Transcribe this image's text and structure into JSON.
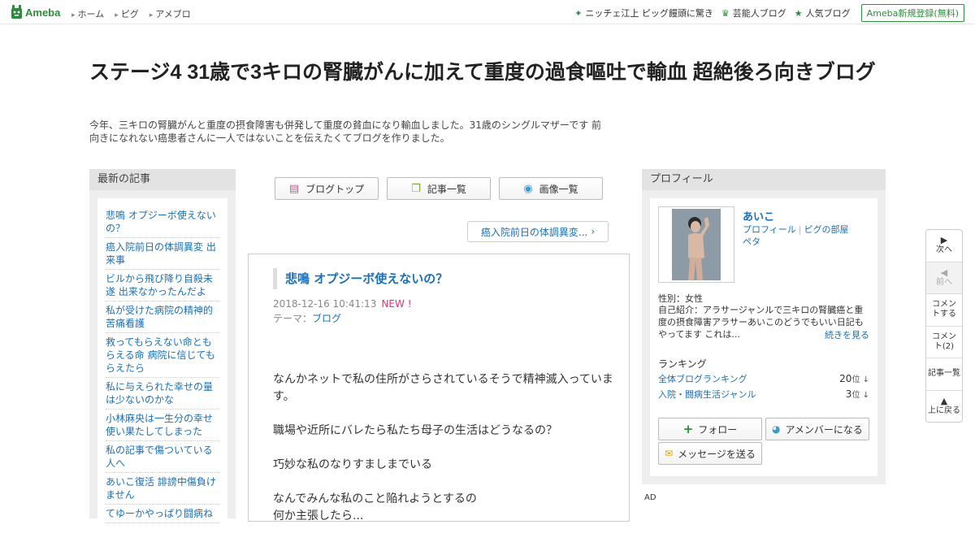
{
  "topbar": {
    "logo_text": "Ameba",
    "nav": [
      "ホーム",
      "ピグ",
      "アメブロ"
    ],
    "links": [
      {
        "icon": "sparkle-icon",
        "label": "ニッチェ江上 ピッグ饅頭に驚き"
      },
      {
        "icon": "crown-icon",
        "label": "芸能人ブログ"
      },
      {
        "icon": "star-icon",
        "label": "人気ブログ"
      }
    ],
    "register_label": "Ameba新規登録(無料)"
  },
  "header": {
    "title": "ステージ4 31歳で3キロの腎臓がんに加えて重度の過食嘔吐で輸血 超絶後ろ向きブログ",
    "description": "今年、三キロの腎臓がんと重度の摂食障害も併発して重度の貧血になり輸血しました。31歳のシングルマザーです 前向きになれない癌患者さんに一人ではないことを伝えたくてブログを作りました。"
  },
  "left": {
    "heading": "最新の記事",
    "items": [
      "悲鳴 オプジーボ使えないの？",
      "癌入院前日の体調異変 出来事",
      "ビルから飛び降り自殺未遂 出来なかったんだよ",
      "私が受けた病院の精神的苦痛看護",
      "救ってもらえない命ともらえる命 病院に信じてもらえたら",
      "私に与えられた幸せの量は少ないのかな",
      "小林麻央は一生分の幸せ使い果たしてしまった",
      "私の記事で傷ついている人へ",
      "あいこ復活 誹謗中傷負けません",
      "てゆーかやっぱり闘病ね"
    ]
  },
  "center": {
    "tabs": [
      "ブログトップ",
      "記事一覧",
      "画像一覧"
    ],
    "prev_entry": "癌入院前日の体調異変...",
    "article": {
      "title": "悲鳴 オプジーボ使えないの？",
      "date": "2018-12-16 10:41:13",
      "new_badge": "NEW !",
      "theme_label": "テーマ：",
      "theme": "ブログ",
      "paragraphs": [
        "なんかネットで私の住所がさらされているそうで精神滅入っています。",
        "職場や近所にバレたら私たち母子の生活はどうなるの？",
        "巧妙な私のなりすましまでいる",
        "なんでみんな私のこと陥れようとするの",
        "何か主張したら..."
      ]
    }
  },
  "right": {
    "heading": "プロフィール",
    "name": "あいこ",
    "link_profile": "プロフィール",
    "link_pig": "ピグの部屋",
    "link_peta": "ペタ",
    "gender": "性別：女性",
    "intro": "自己紹介：アラサージャンルで三キロの腎臓癌と重度の摂食障害アラサーあいこのどうでもいい日記もやってます これは...",
    "more": "続きを見る",
    "ranking_heading": "ランキング",
    "ranking": [
      {
        "label": "全体ブログランキング",
        "value": "20",
        "unit": "位 ↓"
      },
      {
        "label": "入院・闘病生活ジャンル",
        "value": "3",
        "unit": "位 ↓"
      }
    ],
    "follow": "フォロー",
    "amember": "アメンバーになる",
    "message": "メッセージを送る",
    "ad": "AD"
  },
  "sidenav": {
    "next": "次へ",
    "prev": "前へ",
    "comment": "コメントする",
    "comment_count": "コメント(2)",
    "list": "記事一覧",
    "top": "上に戻る"
  },
  "colors": {
    "accent": "#2d8c3c",
    "link": "#1a6fb8",
    "new": "#e0307d"
  }
}
